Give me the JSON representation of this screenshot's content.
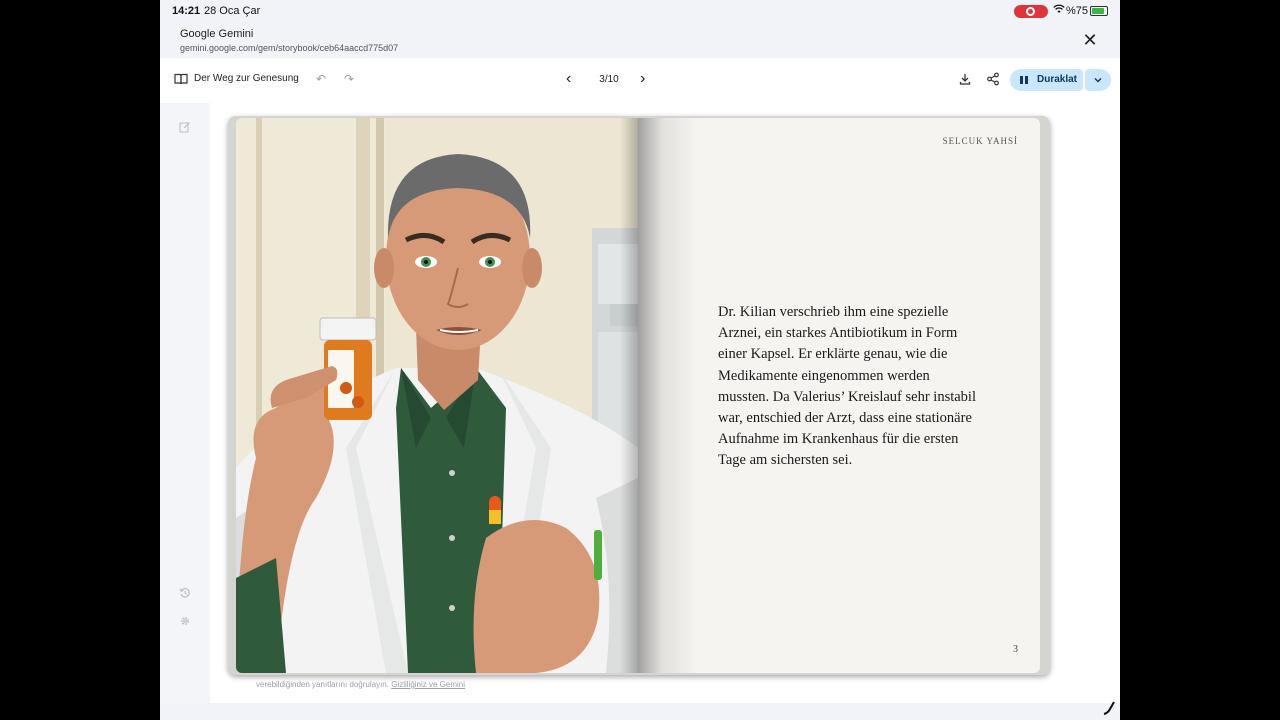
{
  "status_bar": {
    "time": "14:21",
    "date": "28 Oca Çar",
    "battery_text": "%75",
    "battery_level": 0.75,
    "recording_color": "#e0343b"
  },
  "app": {
    "title": "Google Gemini",
    "url": "gemini.google.com/gem/storybook/ceb64aaccd775d07",
    "close_icon": "close-icon"
  },
  "toolbar": {
    "story_title": "Der Weg zur Genesung",
    "page_indicator": "3/10",
    "pause_label": "Duraklat",
    "accent_color": "#c9e6fd"
  },
  "book": {
    "author": "SELCUK YAHSİ",
    "text": "Dr. Kilian verschrieb ihm eine spezielle Arznei, ein starkes Antibiotikum in Form einer Kapsel. Er erklärte genau, wie die Medikamente eingenommen werden mussten. Da Valerius’ Kreislauf sehr instabil war, entschied der Arzt, dass eine stationäre Aufnahme im Krankenhaus für die ersten Tage am sichersten sei.",
    "page_number": "3"
  },
  "footer": {
    "disclaimer": "verebildiğinden yanıtlarını doğrulayın.",
    "privacy_link": "Gizliliğiniz ve Gemini"
  }
}
